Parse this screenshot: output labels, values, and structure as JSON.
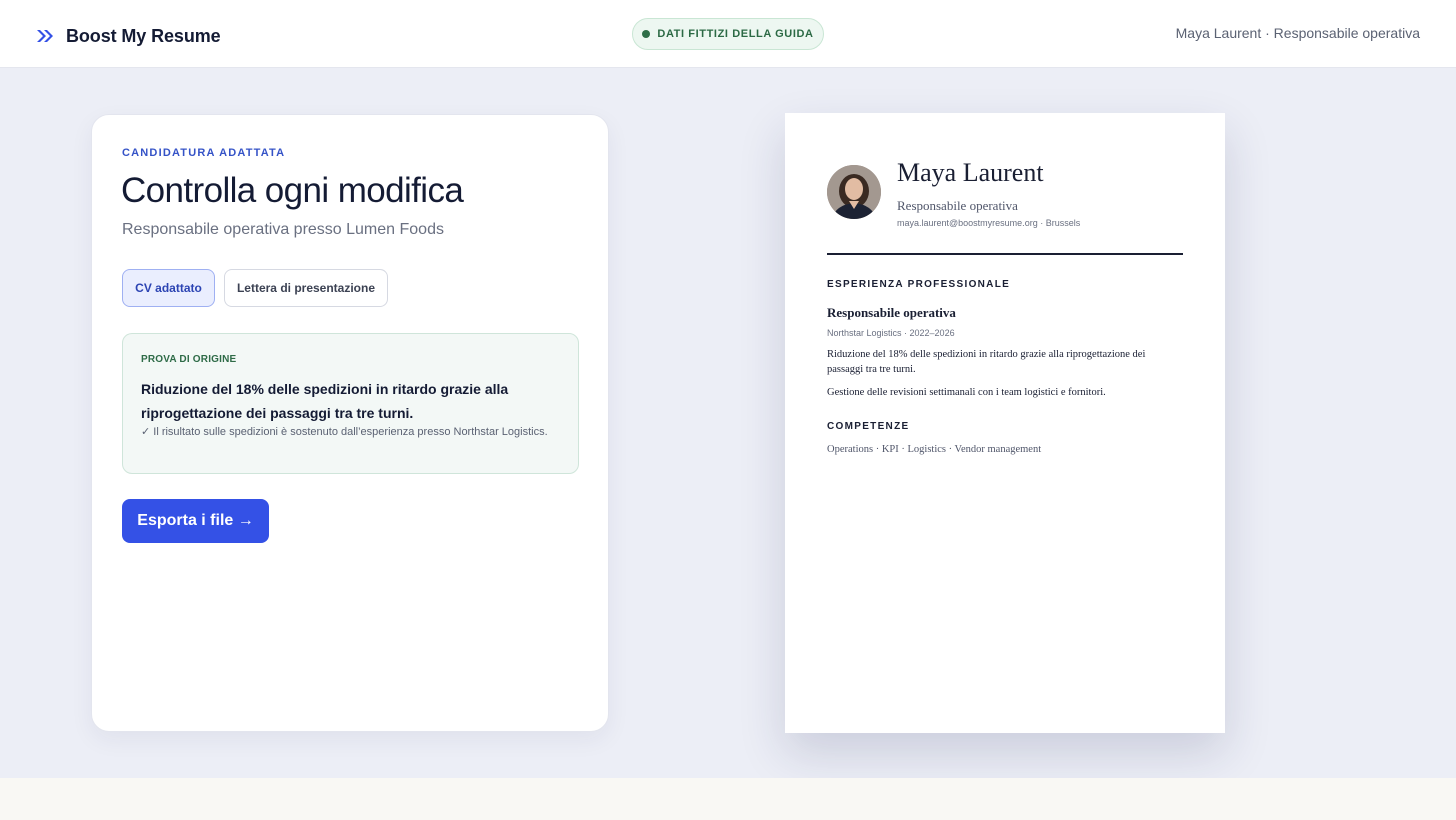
{
  "header": {
    "brand_name": "Boost My Resume",
    "brand_icon": "double-chevron-right-icon",
    "demo_badge": "DATI FITTIZI DELLA GUIDA",
    "user_meta": "Maya Laurent · Responsabile operativa"
  },
  "editor": {
    "eyebrow": "CANDIDATURA ADATTATA",
    "title": "Controlla ogni modifica",
    "subtitle": "Responsabile operativa presso Lumen Foods",
    "tabs": [
      {
        "label": "CV adattato",
        "active": true
      },
      {
        "label": "Lettera di presentazione",
        "active": false
      }
    ],
    "proof": {
      "label": "PROVA DI ORIGINE",
      "text": "Riduzione del 18% delle spedizioni in ritardo grazie alla riprogettazione dei passaggi tra tre turni.",
      "note": "✓ Il risultato sulle spedizioni è sostenuto dall’esperienza presso Northstar Logistics."
    },
    "export_label": "Esporta i file →"
  },
  "resume": {
    "name": "Maya Laurent",
    "role": "Responsabile operativa",
    "contact": "maya.laurent@boostmyresume.org · Brussels",
    "experience_heading": "ESPERIENZA PROFESSIONALE",
    "job": {
      "title": "Responsabile operativa",
      "meta": "Northstar Logistics · 2022–2026",
      "bullets": [
        "Riduzione del 18% delle spedizioni in ritardo grazie alla riprogettazione dei passaggi tra tre turni.",
        "Gestione delle revisioni settimanali con i team logistici e fornitori."
      ]
    },
    "skills_heading": "COMPETENZE",
    "skills": "Operations · KPI · Logistics · Vendor management"
  },
  "colors": {
    "accent": "#3451e6",
    "background": "#eceef6",
    "success": "#2e6b47"
  }
}
